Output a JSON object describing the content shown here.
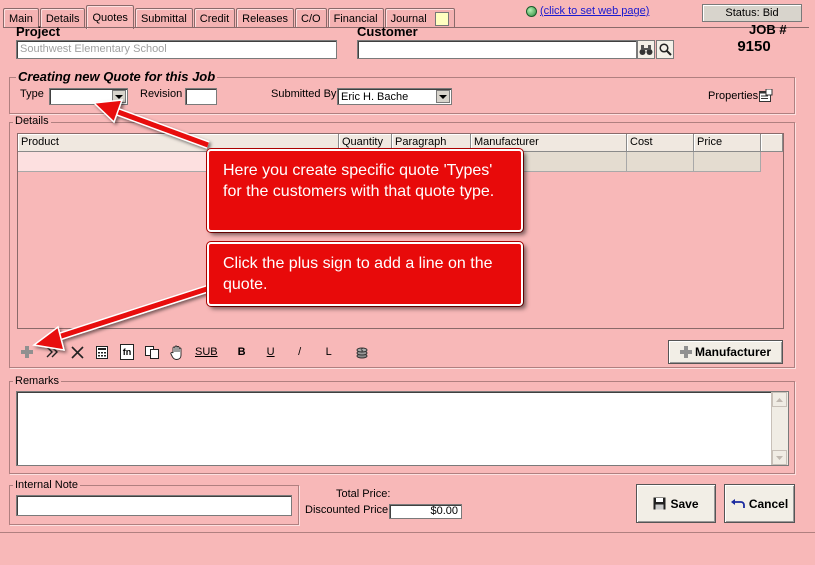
{
  "tabs": [
    "Main",
    "Details",
    "Quotes",
    "Submittal",
    "Credit",
    "Releases",
    "C/O",
    "Financial",
    "Journal"
  ],
  "active_tab": "Quotes",
  "web_link": "(click to set web page)",
  "status": "Status: Bid",
  "project": {
    "label": "Project",
    "value": "Southwest Elementary School"
  },
  "customer": {
    "label": "Customer",
    "value": ""
  },
  "job": {
    "label": "JOB #",
    "number": "9150"
  },
  "quote_header": {
    "title": "Creating new Quote for this Job",
    "type_label": "Type",
    "type_value": "",
    "revision_label": "Revision",
    "revision_value": "",
    "submitted_by_label": "Submitted By",
    "submitted_by_value": "Eric H. Bache",
    "properties_label": "Properties"
  },
  "details": {
    "label": "Details",
    "columns": [
      "Product",
      "Quantity",
      "Paragraph",
      "Manufacturer",
      "Cost",
      "Price"
    ]
  },
  "toolbar": {
    "sub_label": "SUB",
    "bold_label": "B",
    "underline_label": "U",
    "italic_label": "/",
    "l_label": "L",
    "fn_label": "fn",
    "manufacturer_button": "Manufacturer"
  },
  "remarks": {
    "label": "Remarks",
    "value": ""
  },
  "internal_note": {
    "label": "Internal Note",
    "value": ""
  },
  "totals": {
    "total_price_label": "Total Price:",
    "total_price_value": "",
    "discounted_label": "Discounted Price:",
    "discounted_value": "$0.00"
  },
  "buttons": {
    "save": "Save",
    "cancel": "Cancel"
  },
  "callouts": [
    "Here you create specific quote 'Types' for the customers with that quote type.",
    "Click the plus sign to add a line on the quote."
  ],
  "colors": {
    "background": "#f8b8b8",
    "callout": "#e80a0a",
    "link": "#1a1ad0"
  }
}
